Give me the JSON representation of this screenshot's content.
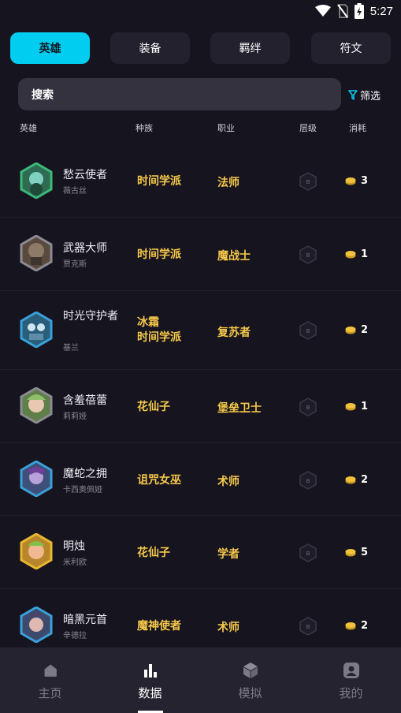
{
  "status": {
    "time": "5:27"
  },
  "tabs": [
    {
      "label": "英雄",
      "active": true
    },
    {
      "label": "装备",
      "active": false
    },
    {
      "label": "羁绊",
      "active": false
    },
    {
      "label": "符文",
      "active": false
    }
  ],
  "search": {
    "placeholder": "搜索"
  },
  "filter": {
    "label": "筛选"
  },
  "columns": {
    "hero": "英雄",
    "race": "种族",
    "class": "职业",
    "tier": "层级",
    "cost": "消耗"
  },
  "heroes": [
    {
      "name": "愁云使者",
      "subname": "薇古丝",
      "race": "时间学派",
      "class": "法师",
      "tier": "B",
      "cost": "3",
      "color": "#3cb878"
    },
    {
      "name": "武器大师",
      "subname": "贾克斯",
      "race": "时间学派",
      "class": "魔战士",
      "tier": "B",
      "cost": "1",
      "color": "#8c8a93"
    },
    {
      "name": "时光守护者",
      "subname": "基兰",
      "race": "冰霜 时间学派",
      "race_lines": [
        "冰霜",
        "时间学派"
      ],
      "class": "复苏者",
      "tier": "B",
      "cost": "2",
      "color": "#3aa0d8"
    },
    {
      "name": "含羞蓓蕾",
      "subname": "莉莉娅",
      "race": "花仙子",
      "class": "堡垒卫士",
      "tier": "B",
      "cost": "1",
      "color": "#8c8a93"
    },
    {
      "name": "魔蛇之拥",
      "subname": "卡西奥佩娅",
      "race": "诅咒女巫",
      "class": "术师",
      "tier": "B",
      "cost": "2",
      "color": "#3aa0d8"
    },
    {
      "name": "明烛",
      "subname": "米利欧",
      "race": "花仙子",
      "class": "学者",
      "tier": "B",
      "cost": "5",
      "color": "#e8b730"
    },
    {
      "name": "暗黑元首",
      "subname": "辛德拉",
      "race": "魔神使者",
      "class": "术师",
      "tier": "B",
      "cost": "2",
      "color": "#3aa0d8"
    }
  ],
  "nav": [
    {
      "label": "主页",
      "icon": "home-icon",
      "active": false
    },
    {
      "label": "数据",
      "icon": "bar-chart-icon",
      "active": true
    },
    {
      "label": "模拟",
      "icon": "cube-icon",
      "active": false
    },
    {
      "label": "我的",
      "icon": "profile-icon",
      "active": false
    }
  ],
  "colors": {
    "accent": "#00cdf0",
    "gold": "#f5c84a",
    "background": "#16141f"
  }
}
